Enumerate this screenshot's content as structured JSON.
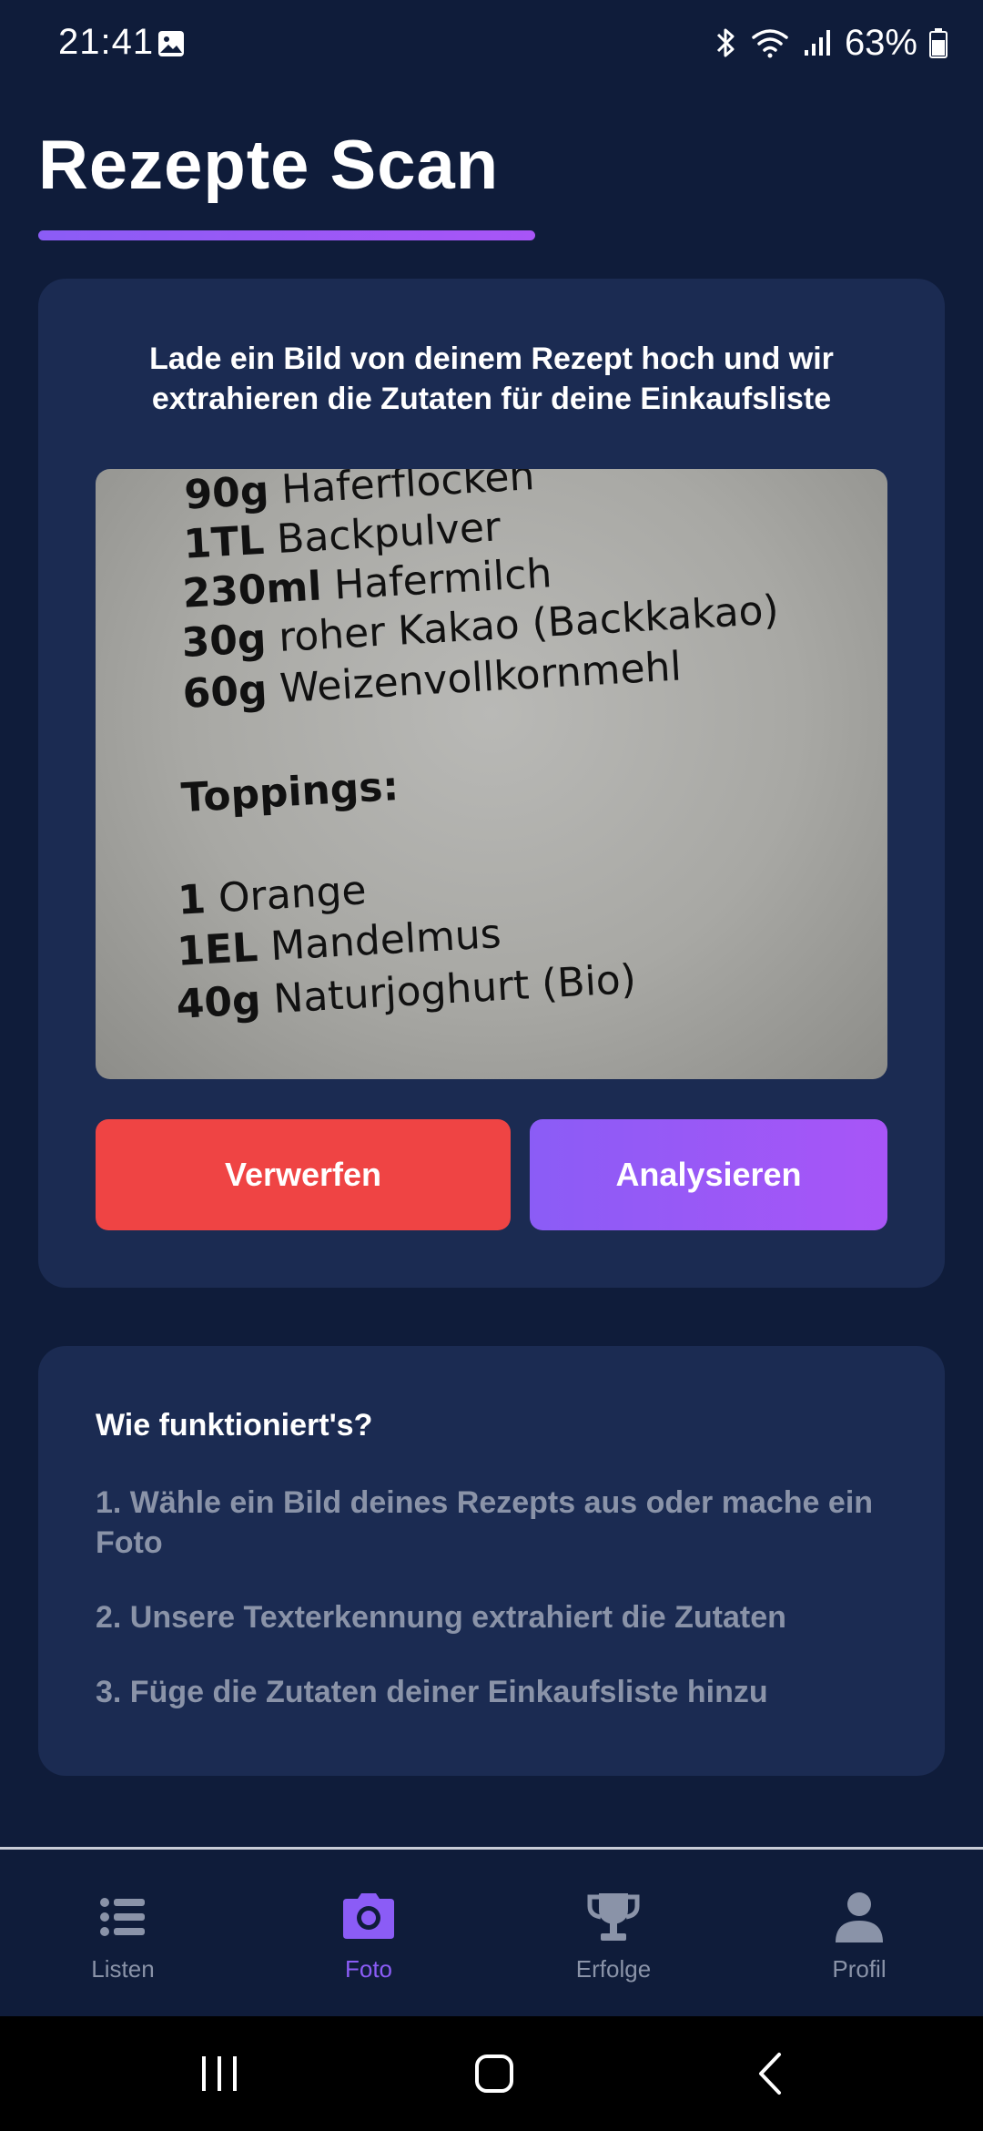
{
  "status_bar": {
    "time": "21:41",
    "battery_percent": "63%",
    "icons": [
      "photo-icon",
      "bluetooth-icon",
      "wifi-icon",
      "signal-icon",
      "battery-icon"
    ]
  },
  "page": {
    "title": "Rezepte Scan"
  },
  "upload_card": {
    "instruction": "Lade ein Bild von deinem Rezept hoch und wir extrahieren die Zutaten für deine Einkaufsliste",
    "recipe_photo_lines": [
      {
        "qty": "90g",
        "text": "Haferflocken"
      },
      {
        "qty": "1TL",
        "text": "Backpulver"
      },
      {
        "qty": "230ml",
        "text": "Hafermilch"
      },
      {
        "qty": "30g",
        "text": "roher Kakao (Backkakao)"
      },
      {
        "qty": "60g",
        "text": "Weizenvollkornmehl"
      },
      {
        "qty": "",
        "text": "Toppings:"
      },
      {
        "qty": "1",
        "text": "Orange"
      },
      {
        "qty": "1EL",
        "text": "Mandelmus"
      },
      {
        "qty": "40g",
        "text": "Naturjoghurt (Bio)"
      }
    ],
    "discard_label": "Verwerfen",
    "analyze_label": "Analysieren"
  },
  "info_card": {
    "heading": "Wie funktioniert's?",
    "steps": [
      "1. Wähle ein Bild deines Rezepts aus oder mache ein Foto",
      "2. Unsere Texterkennung extrahiert die Zutaten",
      "3. Füge die Zutaten deiner Einkaufsliste hinzu"
    ]
  },
  "bottom_nav": {
    "items": [
      {
        "label": "Listen",
        "icon": "list-icon",
        "active": false
      },
      {
        "label": "Foto",
        "icon": "camera-icon",
        "active": true
      },
      {
        "label": "Erfolge",
        "icon": "trophy-icon",
        "active": false
      },
      {
        "label": "Profil",
        "icon": "user-icon",
        "active": false
      }
    ]
  },
  "colors": {
    "background": "#0f1c3a",
    "card": "#1b2b52",
    "accent": "#8b5cf6",
    "danger": "#ef4444",
    "muted_text": "#8a93a8"
  }
}
